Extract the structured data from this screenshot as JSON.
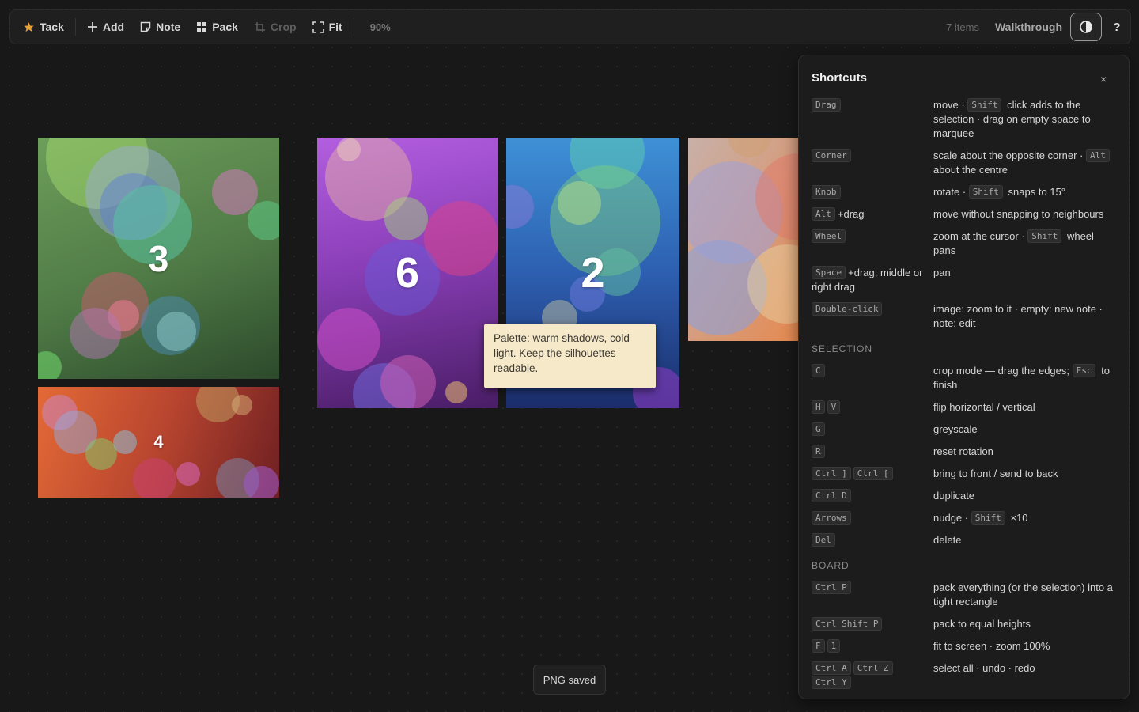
{
  "toolbar": {
    "tack": "Tack",
    "add": "Add",
    "note": "Note",
    "pack": "Pack",
    "crop": "Crop",
    "fit": "Fit",
    "zoom": "90%",
    "item_count": "7 items",
    "walkthrough": "Walkthrough",
    "help": "?",
    "icons": [
      "star-icon",
      "plus-icon",
      "note-icon",
      "grid-icon",
      "crop-icon",
      "fit-icon",
      "contrast-icon"
    ],
    "accent": "#e9a23b"
  },
  "images": [
    {
      "label": "3"
    },
    {
      "label": "4"
    },
    {
      "label": "6"
    },
    {
      "label": "2"
    },
    {
      "label": ""
    }
  ],
  "note": {
    "text": "Palette: warm shadows, cold light. Keep the silhouettes readable.",
    "color": "#f6e9c9"
  },
  "toast": "PNG saved",
  "shortcuts": {
    "title": "Shortcuts",
    "close": "×",
    "general": [
      {
        "keys": [
          "Drag"
        ],
        "desc": [
          {
            "t": "move · "
          },
          {
            "k": "Shift"
          },
          {
            "t": " click adds to the selection · drag on empty space to marquee"
          }
        ]
      },
      {
        "keys": [
          "Corner"
        ],
        "desc": [
          {
            "t": "scale about the opposite corner · "
          },
          {
            "k": "Alt"
          },
          {
            "t": " about the centre"
          }
        ]
      },
      {
        "keys": [
          "Knob"
        ],
        "desc": [
          {
            "t": "rotate · "
          },
          {
            "k": "Shift"
          },
          {
            "t": " snaps to 15°"
          }
        ]
      },
      {
        "keys": [
          "Alt"
        ],
        "suffix": "+drag",
        "desc": [
          {
            "t": "move without snapping to neighbours"
          }
        ]
      },
      {
        "keys": [
          "Wheel"
        ],
        "desc": [
          {
            "t": "zoom at the cursor · "
          },
          {
            "k": "Shift"
          },
          {
            "t": " wheel pans"
          }
        ]
      },
      {
        "keys": [
          "Space"
        ],
        "suffix": "+drag, middle or right drag",
        "desc": [
          {
            "t": "pan"
          }
        ]
      },
      {
        "keys": [
          "Double-click"
        ],
        "desc": [
          {
            "t": "image: zoom to it · empty: new note · note: edit"
          }
        ]
      }
    ],
    "selection_heading": "SELECTION",
    "selection": [
      {
        "keys": [
          "C"
        ],
        "desc": [
          {
            "t": "crop mode — drag the edges; "
          },
          {
            "k": "Esc"
          },
          {
            "t": " to finish"
          }
        ]
      },
      {
        "keys": [
          "H",
          "V"
        ],
        "desc": [
          {
            "t": "flip horizontal / vertical"
          }
        ]
      },
      {
        "keys": [
          "G"
        ],
        "desc": [
          {
            "t": "greyscale"
          }
        ]
      },
      {
        "keys": [
          "R"
        ],
        "desc": [
          {
            "t": "reset rotation"
          }
        ]
      },
      {
        "keys": [
          "Ctrl ]",
          "Ctrl ["
        ],
        "desc": [
          {
            "t": "bring to front / send to back"
          }
        ]
      },
      {
        "keys": [
          "Ctrl D"
        ],
        "desc": [
          {
            "t": "duplicate"
          }
        ]
      },
      {
        "keys": [
          "Arrows"
        ],
        "desc": [
          {
            "t": "nudge · "
          },
          {
            "k": "Shift"
          },
          {
            "t": " ×10"
          }
        ]
      },
      {
        "keys": [
          "Del"
        ],
        "desc": [
          {
            "t": "delete"
          }
        ]
      }
    ],
    "board_heading": "BOARD",
    "board": [
      {
        "keys": [
          "Ctrl P"
        ],
        "desc": [
          {
            "t": "pack everything (or the selection) into a tight rectangle"
          }
        ]
      },
      {
        "keys": [
          "Ctrl Shift P"
        ],
        "desc": [
          {
            "t": "pack to equal heights"
          }
        ]
      },
      {
        "keys": [
          "F",
          "1"
        ],
        "desc": [
          {
            "t": "fit to screen · zoom 100%"
          }
        ]
      },
      {
        "keys": [
          "Ctrl A",
          "Ctrl Z",
          "Ctrl Y"
        ],
        "desc": [
          {
            "t": "select all · undo · redo"
          }
        ]
      }
    ]
  }
}
